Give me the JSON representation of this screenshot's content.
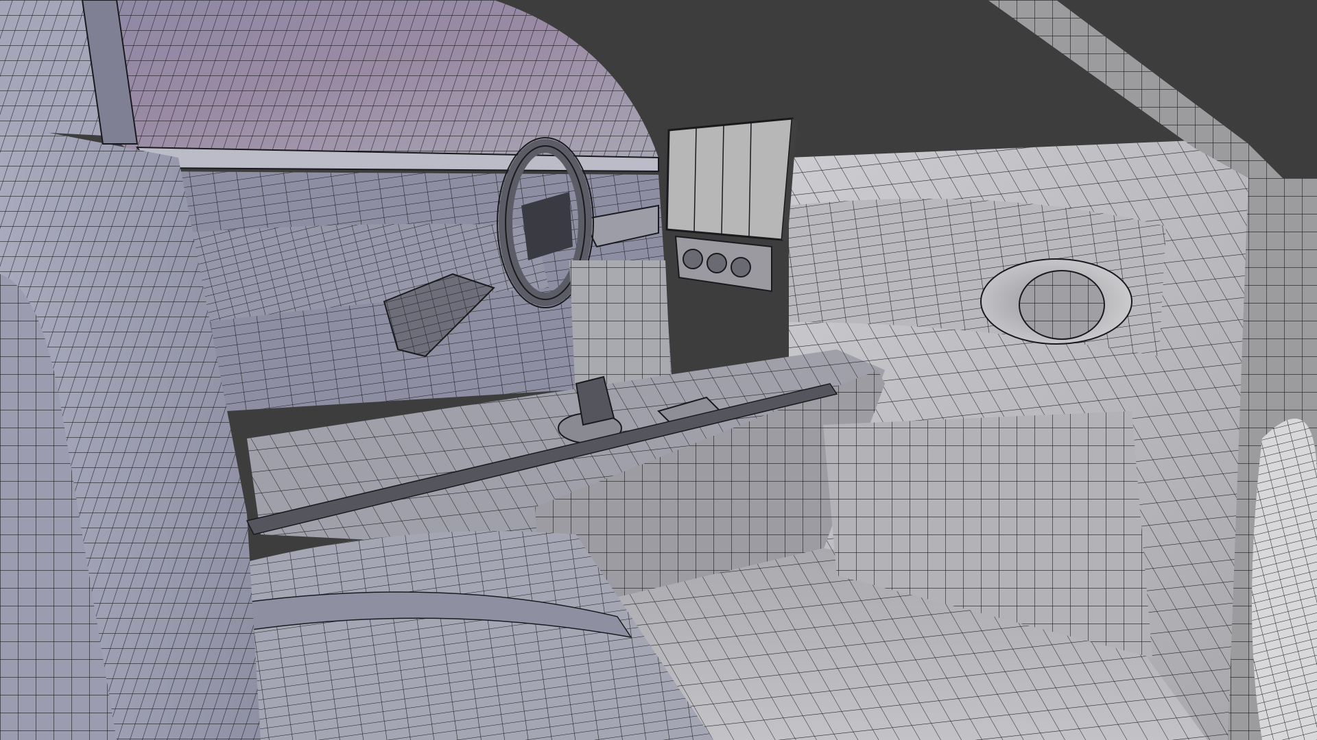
{
  "viewport": {
    "background_color": "#3d3d3d",
    "shading": "solid-wireframe",
    "wire_color": "#1a1a1e",
    "colors": {
      "body_light": "#b9bac6",
      "body_mid": "#9c9cad",
      "body_dark": "#7e7f92",
      "headliner": "#8a7f98",
      "dash_light": "#c4c4c8",
      "dash_mid": "#aaaaae",
      "floor": "#b0b0b4",
      "screen": "#b7b7b7"
    },
    "object": "car-interior-mesh"
  }
}
